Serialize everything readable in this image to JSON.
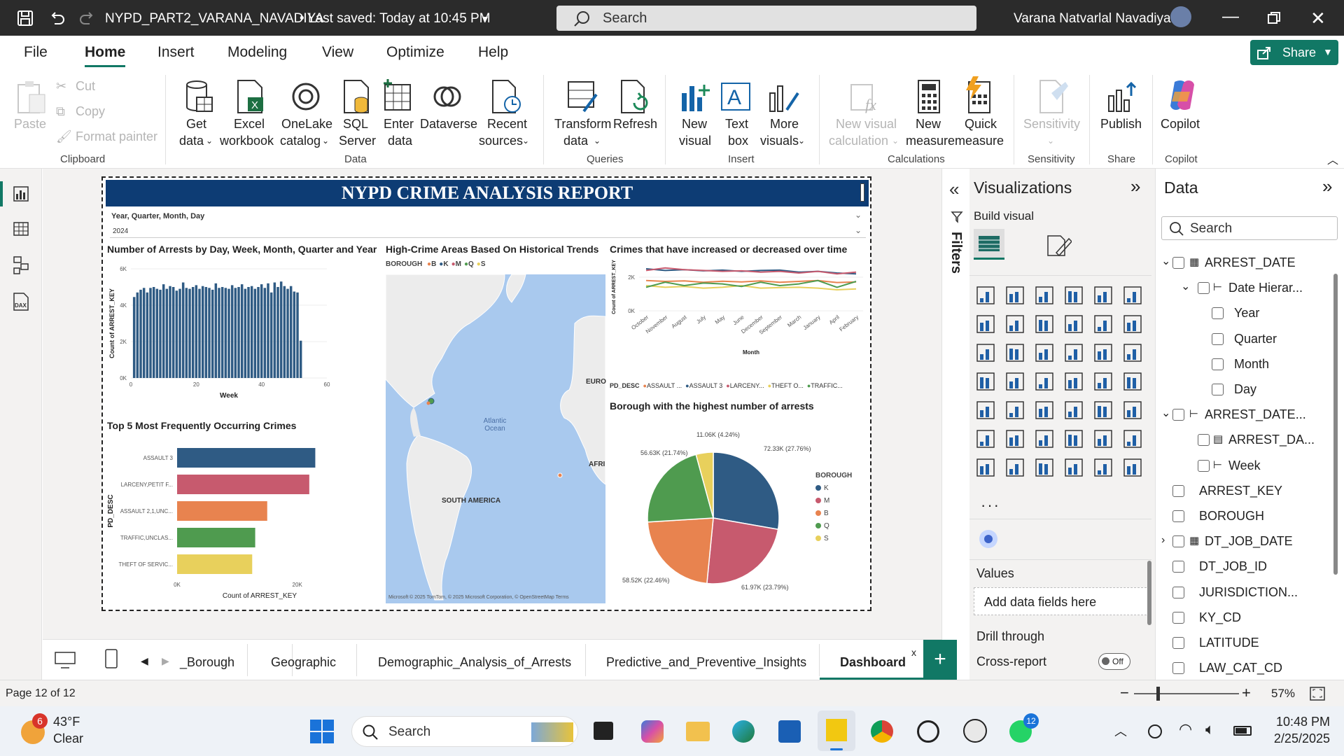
{
  "title": {
    "file": "NYPD_PART2_VARANA_NAVADIYA",
    "saved": "Last saved: Today at 10:45 PM",
    "search": "Search",
    "user": "Varana Natvarlal Navadiya",
    "share": "Share"
  },
  "menu": {
    "file": "File",
    "home": "Home",
    "insert": "Insert",
    "modeling": "Modeling",
    "view": "View",
    "optimize": "Optimize",
    "help": "Help"
  },
  "ribbon": {
    "paste": "Paste",
    "cut": "Cut",
    "copy": "Copy",
    "format_painter": "Format painter",
    "clipboard": "Clipboard",
    "get": "Get",
    "get2": "data",
    "excel": "Excel",
    "excel2": "workbook",
    "onelake": "OneLake",
    "onelake2": "catalog",
    "sql": "SQL",
    "sql2": "Server",
    "enter": "Enter",
    "enter2": "data",
    "dataverse": "Dataverse",
    "recent": "Recent",
    "recent2": "sources",
    "data": "Data",
    "transform": "Transform",
    "transform2": "data",
    "refresh": "Refresh",
    "queries": "Queries",
    "newvis": "New",
    "newvis2": "visual",
    "textbox": "Text",
    "textbox2": "box",
    "more": "More",
    "more2": "visuals",
    "insert": "Insert",
    "nvc": "New visual",
    "nvc2": "calculation",
    "nm": "New",
    "nm2": "measure",
    "qm": "Quick",
    "qm2": "measure",
    "calc": "Calculations",
    "sens": "Sensitivity",
    "sensg": "Sensitivity",
    "publish": "Publish",
    "shareg": "Share",
    "copilot": "Copilot",
    "copilotg": "Copilot"
  },
  "report": {
    "title": "NYPD CRIME ANALYSIS REPORT",
    "slicer_label": "Year, Quarter, Month, Day",
    "slicer_value": "2024",
    "c1": {
      "title": "Number of Arrests by Day, Week, Month, Quarter and Year",
      "ylabel": "Count of ARREST_KEY",
      "xlabel": "Week"
    },
    "c2": {
      "title": "High-Crime Areas Based On Historical Trends",
      "legend_title": "BOROUGH",
      "legend": [
        {
          "t": "B",
          "c": "#e8834f"
        },
        {
          "t": "K",
          "c": "#2f5b84"
        },
        {
          "t": "M",
          "c": "#c75a6e"
        },
        {
          "t": "Q",
          "c": "#4f9b4f"
        },
        {
          "t": "S",
          "c": "#e8d05c"
        }
      ],
      "atlantic": "Atlantic",
      "ocean": "Ocean",
      "euro": "EURO",
      "afri": "AFRI",
      "sa": "SOUTH AMERICA",
      "copyright": "© 2025 TomTom, © 2025 Microsoft Corporation, © OpenStreetMap  Terms",
      "ms": "Microsoft"
    },
    "c3": {
      "title": "Crimes that have increased or decreased over time",
      "ylabel": "Count of ARREST_KEY",
      "xlabel": "Month",
      "legend_title": "PD_DESC",
      "legend": [
        "ASSAULT ...",
        "ASSAULT 3",
        "LARCENY...",
        "THEFT O...",
        "TRAFFIC..."
      ]
    },
    "c4": {
      "title": "Top 5 Most Frequently Occurring Crimes",
      "ylabel": "PD_DESC",
      "xlabel": "Count of ARREST_KEY"
    },
    "c5": {
      "title": "Borough with the highest number of arrests",
      "legend_title": "BOROUGH"
    }
  },
  "chart_data": [
    {
      "type": "bar",
      "title": "Number of Arrests by Day, Week, Month, Quarter and Year",
      "xlabel": "Week",
      "ylabel": "Count of ARREST_KEY",
      "xlim": [
        0,
        60
      ],
      "ylim": [
        0,
        6000
      ],
      "yticks": [
        "0K",
        "2K",
        "4K",
        "6K"
      ],
      "xticks": [
        "0",
        "20",
        "40",
        "60"
      ],
      "x": [
        1,
        2,
        3,
        4,
        5,
        6,
        7,
        8,
        9,
        10,
        11,
        12,
        13,
        14,
        15,
        16,
        17,
        18,
        19,
        20,
        21,
        22,
        23,
        24,
        25,
        26,
        27,
        28,
        29,
        30,
        31,
        32,
        33,
        34,
        35,
        36,
        37,
        38,
        39,
        40,
        41,
        42,
        43,
        44,
        45,
        46,
        47,
        48,
        49,
        50,
        51,
        52
      ],
      "values": [
        4450,
        4700,
        4850,
        4950,
        4700,
        4950,
        5000,
        4900,
        4850,
        5150,
        4900,
        5050,
        5000,
        4800,
        4900,
        5250,
        4950,
        4900,
        5000,
        5100,
        4900,
        5050,
        5000,
        4950,
        4850,
        5200,
        4950,
        5000,
        4950,
        4900,
        5100,
        4950,
        5000,
        5150,
        4900,
        5000,
        5050,
        4900,
        5000,
        5150,
        4950,
        5200,
        4700,
        5250,
        5000,
        5300,
        5050,
        4900,
        5050,
        4750,
        4700,
        2050
      ],
      "color": "#2f5b84"
    },
    {
      "type": "line",
      "title": "Crimes that have increased or decreased over time",
      "xlabel": "Month",
      "ylabel": "Count of ARREST_KEY",
      "categories": [
        "October",
        "November",
        "August",
        "July",
        "May",
        "June",
        "December",
        "September",
        "March",
        "January",
        "April",
        "February"
      ],
      "yticks": [
        "0K",
        "2K"
      ],
      "ylim": [
        0,
        3000
      ],
      "series": [
        {
          "name": "ASSAULT ...",
          "color": "#e8834f",
          "values": [
            1800,
            1750,
            1780,
            1700,
            1760,
            1720,
            1780,
            1700,
            1750,
            1800,
            1680,
            1720
          ]
        },
        {
          "name": "ASSAULT 3",
          "color": "#2f5b84",
          "values": [
            2500,
            2400,
            2450,
            2380,
            2420,
            2350,
            2400,
            2420,
            2300,
            2350,
            2250,
            2200
          ]
        },
        {
          "name": "LARCENY...",
          "color": "#c75a6e",
          "values": [
            2400,
            2550,
            2450,
            2400,
            2350,
            2380,
            2300,
            2350,
            2250,
            2350,
            2200,
            2300
          ]
        },
        {
          "name": "THEFT O...",
          "color": "#e8d05c",
          "values": [
            1500,
            1400,
            1450,
            1350,
            1400,
            1500,
            1350,
            1380,
            1400,
            1350,
            1250,
            1300
          ]
        },
        {
          "name": "TRAFFIC...",
          "color": "#4f9b4f",
          "values": [
            1400,
            1700,
            1500,
            1650,
            1600,
            1450,
            1700,
            1500,
            1600,
            1800,
            1400,
            1750
          ]
        }
      ]
    },
    {
      "type": "bar",
      "orientation": "horizontal",
      "title": "Top 5 Most Frequently Occurring Crimes",
      "xlabel": "Count of ARREST_KEY",
      "ylabel": "PD_DESC",
      "xticks": [
        "0K",
        "20K"
      ],
      "xlim": [
        0,
        24000
      ],
      "categories": [
        "ASSAULT 3",
        "LARCENY,PETIT F...",
        "ASSAULT 2,1,UNC...",
        "TRAFFIC,UNCLAS...",
        "THEFT OF SERVIC..."
      ],
      "values": [
        23000,
        22000,
        15000,
        13000,
        12500
      ],
      "colors": [
        "#2f5b84",
        "#c75a6e",
        "#e8834f",
        "#4f9b4f",
        "#e8d05c"
      ]
    },
    {
      "type": "pie",
      "title": "Borough with the highest number of arrests",
      "categories": [
        "K",
        "M",
        "B",
        "Q",
        "S"
      ],
      "values": [
        72330,
        61970,
        58520,
        56630,
        11060
      ],
      "labels": [
        "72.33K (27.76%)",
        "61.97K (23.79%)",
        "58.52K (22.46%)",
        "56.63K (21.74%)",
        "11.06K (4.24%)"
      ],
      "colors": [
        "#2f5b84",
        "#c75a6e",
        "#e8834f",
        "#4f9b4f",
        "#e8d05c"
      ]
    }
  ],
  "viz": {
    "title": "Visualizations",
    "build": "Build visual",
    "values": "Values",
    "add": "Add data fields here",
    "drill": "Drill through",
    "cross": "Cross-report",
    "off": "Off",
    "filters": "Filters"
  },
  "datapane": {
    "title": "Data",
    "search": "Search",
    "rows": [
      "ARREST_DATE",
      "Date Hierar...",
      "Year",
      "Quarter",
      "Month",
      "Day",
      "ARREST_DATE...",
      "ARREST_DA...",
      "Week",
      "ARREST_KEY",
      "BOROUGH",
      "DT_JOB_DATE",
      "DT_JOB_ID",
      "JURISDICTION...",
      "KY_CD",
      "LATITUDE",
      "LAW_CAT_CD"
    ]
  },
  "tabs": [
    "_Borough",
    "Geographic",
    "Demographic_Analysis_of_Arrests",
    "Predictive_and_Preventive_Insights",
    "Dashboard"
  ],
  "status": {
    "page": "Page 12 of 12",
    "zoom": "57%"
  },
  "taskbar": {
    "temp": "43°F",
    "weather": "Clear",
    "badge": "6",
    "search": "Search",
    "time": "10:48 PM",
    "date": "2/25/2025",
    "wa": "12"
  }
}
